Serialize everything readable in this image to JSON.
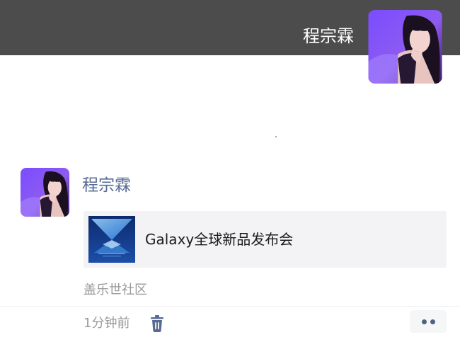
{
  "header": {
    "profile_name": "程宗霖",
    "avatar_icon": "user-avatar-icon"
  },
  "post": {
    "author": "程宗霖",
    "avatar_icon": "user-avatar-icon",
    "shared_card": {
      "title": "Galaxy全球新品发布会",
      "thumbnail_icon": "galaxy-event-thumbnail-icon"
    },
    "source": "盖乐世社区",
    "time": "1分钟前",
    "delete_icon": "trash-icon",
    "more_icon": "more-dots-icon"
  },
  "colors": {
    "banner": "#4c4c4c",
    "name_link": "#576b95",
    "secondary_text": "#9a9a9a",
    "card_bg": "#f3f3f5",
    "icon": "#576b95"
  }
}
